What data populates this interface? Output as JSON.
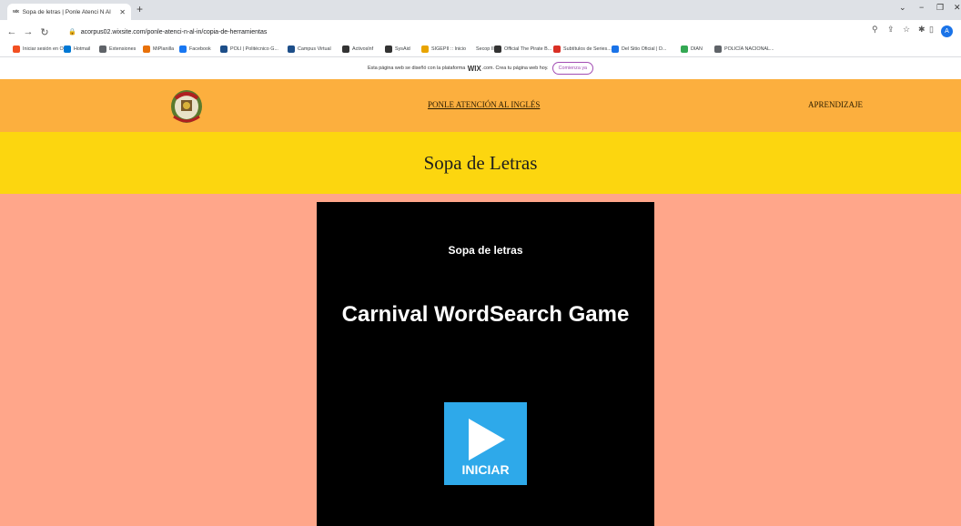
{
  "browser": {
    "tab_title": "Sopa de letras | Ponle Atenci N Al",
    "tab_favicon": "wix",
    "url": "acorpus02.wixsite.com/ponle-atenci-n-al-in/copia-de-herramientas"
  },
  "bookmarks": [
    {
      "label": "Iniciar sesión en Ou...",
      "color": "#f25022"
    },
    {
      "label": "Hotmail",
      "color": "#0078d4"
    },
    {
      "label": "Extensiones",
      "color": "#5f6368"
    },
    {
      "label": "MiPlanilla",
      "color": "#e8710a"
    },
    {
      "label": "Facebook",
      "color": "#1877f2"
    },
    {
      "label": "POLI | Politécnico G...",
      "color": "#1d4e89"
    },
    {
      "label": "Campus Virtual",
      "color": "#1d4e89"
    },
    {
      "label": "Activoslnf",
      "color": "#333333"
    },
    {
      "label": "SysAid",
      "color": "#333333"
    },
    {
      "label": "SIGEPII :: Inicio",
      "color": "#e8a400"
    },
    {
      "label": "Secop II",
      "color": "#ffffff"
    },
    {
      "label": "Official The Pirate B...",
      "color": "#333333"
    },
    {
      "label": "Subtítulos de Series...",
      "color": "#d93025"
    },
    {
      "label": "Del Sitio Oficial | D...",
      "color": "#1a73e8"
    },
    {
      "label": "DIAN",
      "color": "#34a853"
    },
    {
      "label": "POLICÍA NACIONAL...",
      "color": "#5f6368"
    }
  ],
  "wix_banner": {
    "text_before": "Esta página web se diseñó con la plataforma",
    "brand": "WIX",
    "text_after": ".com. Crea tu página web hoy.",
    "cta": "Comienza ya"
  },
  "site": {
    "nav_1": "PONLE ATENCIÓN AL INGLÉS",
    "nav_2": "APRENDIZAJE",
    "page_title": "Sopa de Letras"
  },
  "game": {
    "subtitle": "Sopa de letras",
    "title": "Carnival WordSearch Game",
    "start_label": "INICIAR"
  },
  "profile_initial": "A",
  "colors": {
    "header": "#fcaf3e",
    "title_band": "#fcd60f",
    "content_bg": "#ffa68a",
    "play_button": "#2ea9ea"
  }
}
